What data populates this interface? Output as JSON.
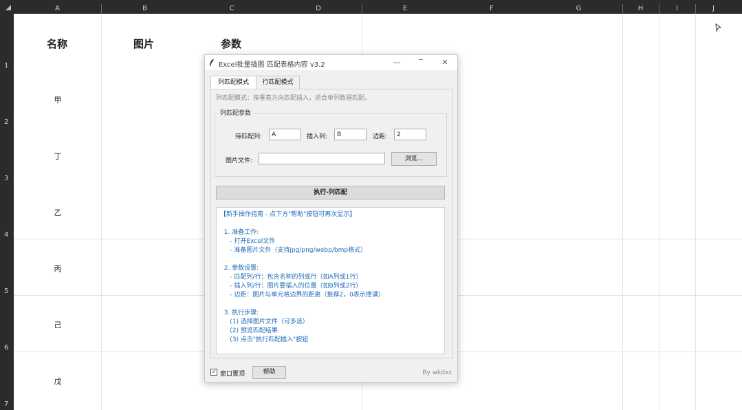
{
  "sheet": {
    "columns": [
      "A",
      "B",
      "C",
      "D",
      "E",
      "F",
      "G",
      "H",
      "I",
      "J"
    ],
    "rows": [
      "1",
      "2",
      "3",
      "4",
      "5",
      "6",
      "7"
    ],
    "headers": {
      "name": "名称",
      "image": "图片",
      "params": "参数"
    },
    "names": [
      "甲",
      "丁",
      "乙",
      "丙",
      "己",
      "戊"
    ]
  },
  "dialog": {
    "title": "Excel批量插图 匹配表格内容 v3.2",
    "minimize": "—",
    "maximize": "‾",
    "close": "✕",
    "tabs": [
      "列匹配模式",
      "行匹配模式"
    ],
    "description": "列匹配模式：按垂直方向匹配插入，适合单列数据匹配。",
    "group_title": "列匹配参数",
    "match_col_label": "待匹配列:",
    "match_col_value": "A",
    "insert_col_label": "插入列:",
    "insert_col_value": "B",
    "margin_label": "边距:",
    "margin_value": "2",
    "file_label": "图片文件:",
    "file_value": "",
    "browse_button": "浏览...",
    "execute_button": "执行-列匹配",
    "guide": [
      "【新手操作指南 - 点下方\"帮助\"按钮可再次显示】",
      "",
      "  1. 准备工作:",
      "     - 打开Excel文件",
      "     - 准备图片文件（支持jpg/png/webp/bmp格式）",
      "",
      "  2. 参数设置:",
      "     - 匹配列/行：包含名称的列或行（如A列或1行）",
      "     - 插入列/行：图片要插入的位置（如B列或2行）",
      "     - 边距：图片与单元格边界的距离（推荐2，0表示撑满）",
      "",
      "  3. 执行步骤:",
      "     (1) 选择图片文件（可多选）",
      "     (2) 预览匹配结果",
      "     (3) 点击\"执行匹配插入\"按钮"
    ],
    "topmost_label": "窗口置顶",
    "topmost_checked": "✓",
    "help_button": "帮助",
    "credit": "By wkdxz"
  }
}
